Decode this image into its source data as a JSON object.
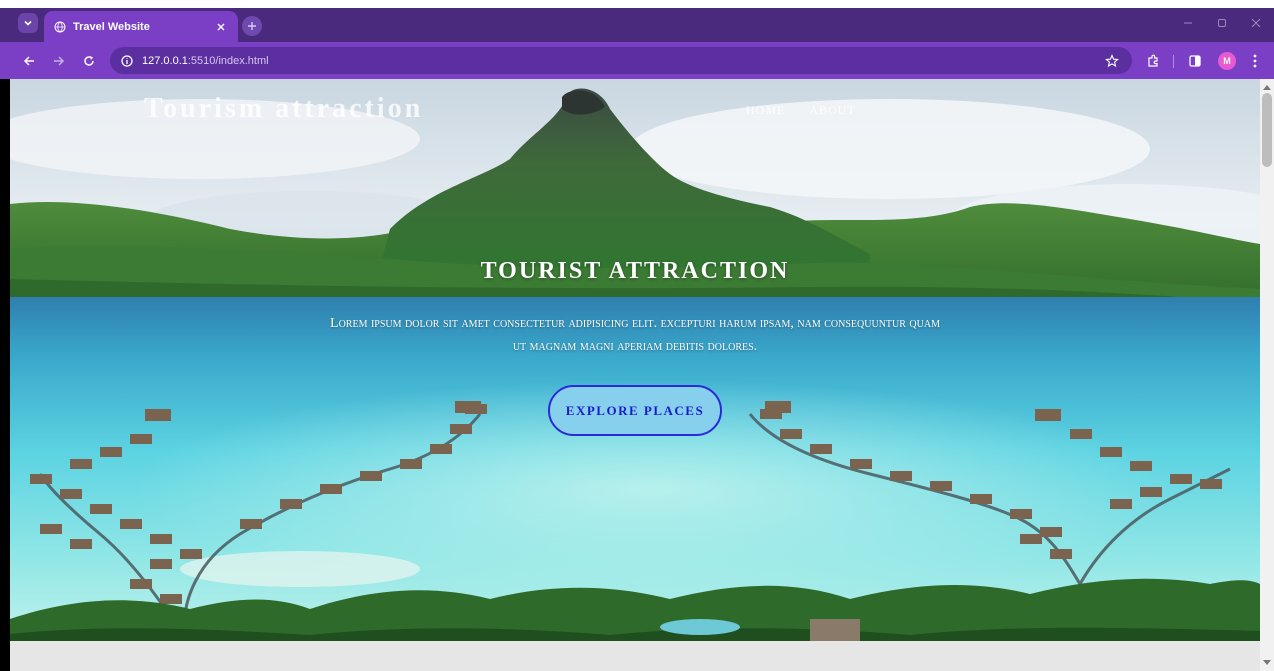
{
  "browser": {
    "tab_title": "Travel Website",
    "url_host": "127.0.0.1",
    "url_rest": ":5510/index.html",
    "profile_initial": "M",
    "icons": [
      "tab-search-icon",
      "globe-icon",
      "close-icon",
      "plus-icon",
      "minimize-icon",
      "maximize-icon",
      "back-icon",
      "forward-icon",
      "reload-icon",
      "info-icon",
      "star-icon",
      "extensions-icon",
      "side-panel-icon",
      "more-icon"
    ],
    "colors": {
      "frame": "#4a2a7c",
      "toolbar": "#7a3fc4",
      "omnibox": "#5b2fa0"
    }
  },
  "page": {
    "logo": "Tourism attraction",
    "nav": [
      "HOME",
      "ABOUT"
    ],
    "hero": {
      "heading": "TOURIST ATTRACTION",
      "text_line_1": "Lorem ipsum dolor sit amet consectetur adipisicing elit. Excepturi harum ipsam, nam consequuntur quam",
      "text_line_2": "ut magnam magni aperiam debitis dolores.",
      "cta": "EXPLORE PLACES",
      "background": "bora-bora-lagoon-photo"
    },
    "colors": {
      "cta_bg": "#86d0ee",
      "cta_border": "#2a2ad8",
      "cta_text": "#1c1cc7"
    }
  }
}
